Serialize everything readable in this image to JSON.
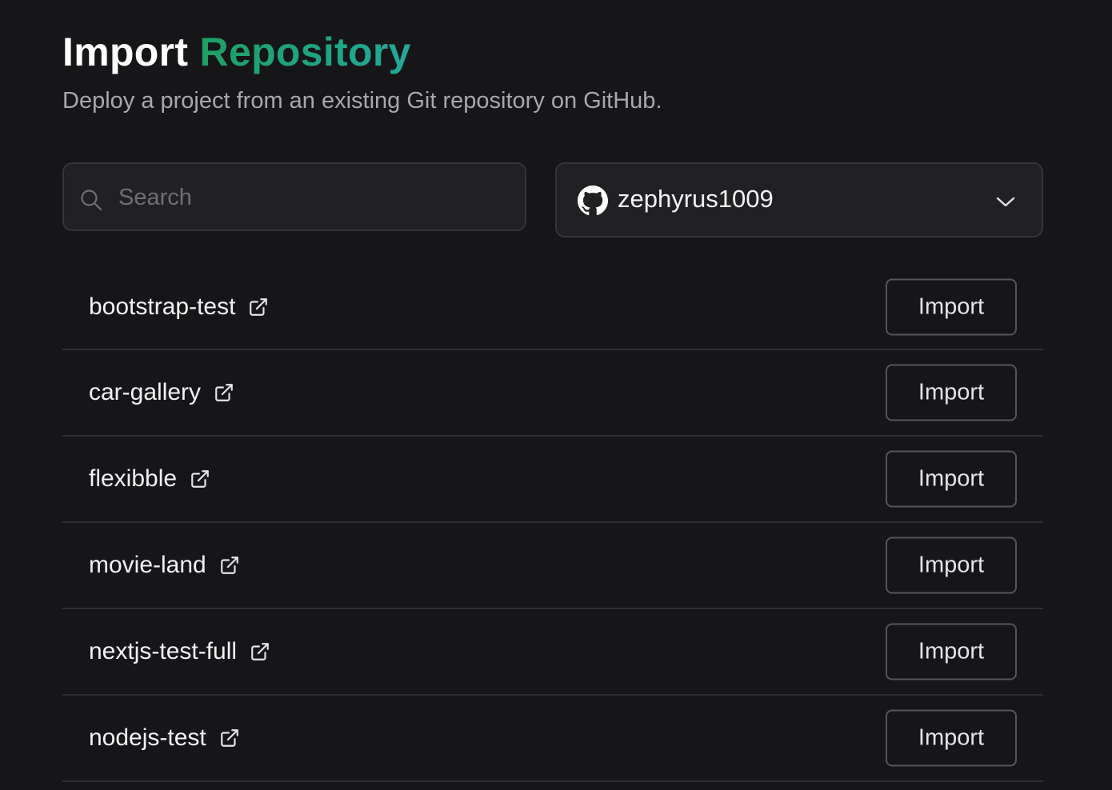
{
  "header": {
    "title_main": "Import",
    "title_accent": "Repository",
    "subtitle": "Deploy a project from an existing Git repository on GitHub."
  },
  "search": {
    "placeholder": "Search",
    "value": ""
  },
  "account": {
    "name": "zephyrus1009",
    "icon": "github-icon"
  },
  "repositories": [
    {
      "name": "bootstrap-test",
      "action": "Import"
    },
    {
      "name": "car-gallery",
      "action": "Import"
    },
    {
      "name": "flexibble",
      "action": "Import"
    },
    {
      "name": "movie-land",
      "action": "Import"
    },
    {
      "name": "nextjs-test-full",
      "action": "Import"
    },
    {
      "name": "nodejs-test",
      "action": "Import"
    }
  ],
  "colors": {
    "background": "#161618",
    "accent_start": "#1f9f63",
    "accent_end": "#22a89a",
    "input_bg": "#212124",
    "divider": "#2e2e33"
  }
}
